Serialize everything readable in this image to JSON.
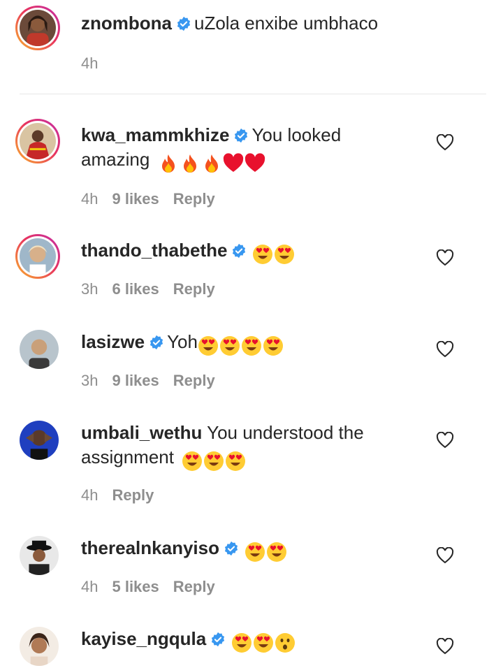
{
  "caption": {
    "username": "znombona",
    "text": "uZola enxibe umbhaco",
    "time": "4h"
  },
  "comments": [
    {
      "username": "kwa_mammkhize",
      "verified": true,
      "line1": "You looked",
      "line2": "amazing",
      "emojis": [
        "fire-emoji",
        "fire-emoji",
        "fire-emoji",
        "red-heart-emoji",
        "red-heart-emoji"
      ],
      "time": "4h",
      "likes": "9 likes",
      "reply": "Reply"
    },
    {
      "username": "thando_thabethe",
      "verified": true,
      "line1": "",
      "emojis": [
        "heart-eyes-emoji",
        "heart-eyes-emoji"
      ],
      "time": "3h",
      "likes": "6 likes",
      "reply": "Reply"
    },
    {
      "username": "lasizwe",
      "verified": true,
      "line1": "Yoh",
      "emojis": [
        "heart-eyes-emoji",
        "heart-eyes-emoji",
        "heart-eyes-emoji",
        "heart-eyes-emoji"
      ],
      "time": "3h",
      "likes": "9 likes",
      "reply": "Reply"
    },
    {
      "username": "umbali_wethu",
      "verified": false,
      "line1": "You understood the",
      "line2": "assignment",
      "emojis": [
        "heart-eyes-emoji",
        "heart-eyes-emoji",
        "heart-eyes-emoji"
      ],
      "time": "4h",
      "likes": "",
      "reply": "Reply"
    },
    {
      "username": "therealnkanyiso",
      "verified": true,
      "line1": "",
      "emojis": [
        "heart-eyes-emoji",
        "heart-eyes-emoji"
      ],
      "time": "4h",
      "likes": "5 likes",
      "reply": "Reply"
    },
    {
      "username": "kayise_ngqula",
      "verified": true,
      "line1": "",
      "emojis": [
        "heart-eyes-emoji",
        "heart-eyes-emoji",
        "hushed-face-emoji"
      ],
      "time": "",
      "likes": "",
      "reply": ""
    }
  ],
  "icons": {
    "verified": "verified-badge-icon",
    "like": "heart-outline-icon"
  },
  "colors": {
    "verified_blue": "#3897f0",
    "meta_gray": "#8e8e8e",
    "text": "#262626"
  }
}
